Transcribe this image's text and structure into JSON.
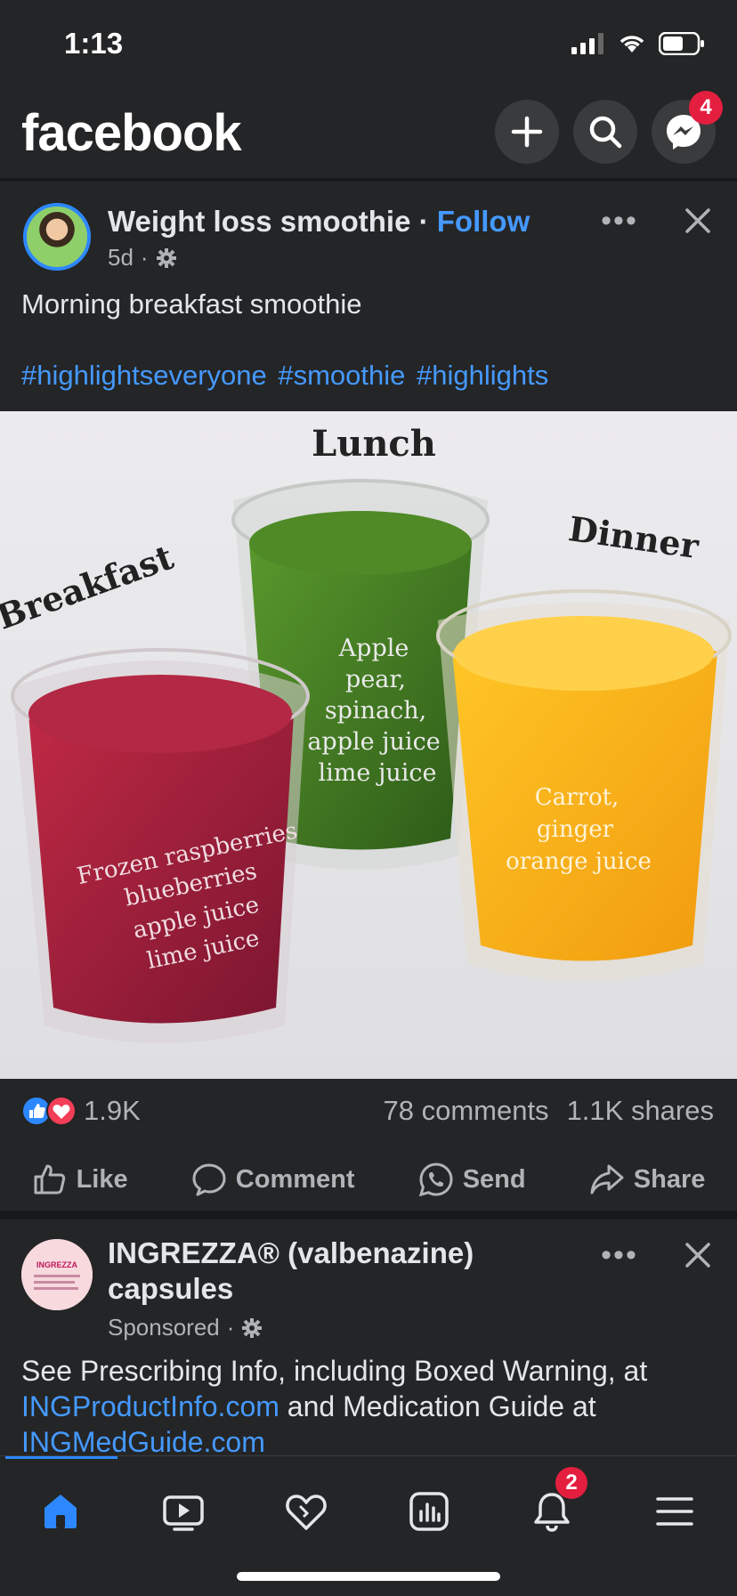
{
  "status": {
    "time": "1:13"
  },
  "header": {
    "logo": "facebook",
    "messenger_badge": "4"
  },
  "post": {
    "page_name": "Weight loss smoothie",
    "separator": " · ",
    "follow": "Follow",
    "age": "5d",
    "meta_sep": "·",
    "text": "Morning breakfast smoothie",
    "hashtags": "#highlightseveryone #smoothie  #highlights",
    "image": {
      "labels": {
        "breakfast": "Breakfast",
        "lunch": "Lunch",
        "dinner": "Dinner"
      },
      "glass_red": [
        "Frozen raspberries",
        "blueberries",
        "apple juice",
        "lime juice"
      ],
      "glass_green": [
        "Apple",
        "pear,",
        "spinach,",
        "apple juice",
        "lime juice"
      ],
      "glass_orange": [
        "Carrot,",
        "ginger",
        "orange juice"
      ]
    },
    "reactions_count": "1.9K",
    "comments": "78 comments",
    "shares": "1.1K shares",
    "actions": {
      "like": "Like",
      "comment": "Comment",
      "send": "Send",
      "share": "Share"
    }
  },
  "ad": {
    "name": "INGREZZA® (valbenazine) capsules",
    "sponsored": "Sponsored",
    "meta_sep": "·",
    "logo_text": "INGREZZA",
    "text_1": "See Prescribing Info, including Boxed Warning, at ",
    "link_1": "INGProductInfo.com",
    "text_2": " and Medication Guide at ",
    "link_2": "INGMedGuide.com"
  },
  "tabbar": {
    "notifications_badge": "2"
  },
  "colors": {
    "accent": "#2d88ff",
    "link": "#4599ff",
    "badge": "#e41e3f",
    "background": "#242526"
  }
}
